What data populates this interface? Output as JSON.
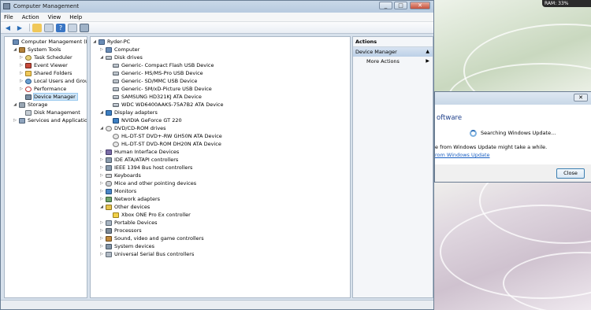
{
  "window": {
    "title": "Computer Management",
    "minimize": "_",
    "maximize": "□",
    "close": "✕"
  },
  "menu": [
    "File",
    "Action",
    "View",
    "Help"
  ],
  "left_tree": [
    {
      "label": "Computer Management (Local",
      "indent": 0,
      "exp": "",
      "icon": "comp"
    },
    {
      "label": "System Tools",
      "indent": 1,
      "exp": "◢",
      "icon": "tool"
    },
    {
      "label": "Task Scheduler",
      "indent": 2,
      "exp": "▷",
      "icon": "clock"
    },
    {
      "label": "Event Viewer",
      "indent": 2,
      "exp": "▷",
      "icon": "evt"
    },
    {
      "label": "Shared Folders",
      "indent": 2,
      "exp": "▷",
      "icon": "fold"
    },
    {
      "label": "Local Users and Groups",
      "indent": 2,
      "exp": "▷",
      "icon": "users"
    },
    {
      "label": "Performance",
      "indent": 2,
      "exp": "▷",
      "icon": "perf"
    },
    {
      "label": "Device Manager",
      "indent": 2,
      "exp": "",
      "icon": "dev",
      "selected": true
    },
    {
      "label": "Storage",
      "indent": 1,
      "exp": "◢",
      "icon": "stor"
    },
    {
      "label": "Disk Management",
      "indent": 2,
      "exp": "",
      "icon": "disk"
    },
    {
      "label": "Services and Applications",
      "indent": 1,
      "exp": "▷",
      "icon": "svc"
    }
  ],
  "device_tree": [
    {
      "label": "Ryder-PC",
      "indent": 0,
      "exp": "◢",
      "icon": "comp"
    },
    {
      "label": "Computer",
      "indent": 1,
      "exp": "▷",
      "icon": "comp"
    },
    {
      "label": "Disk drives",
      "indent": 1,
      "exp": "◢",
      "icon": "drive"
    },
    {
      "label": "Generic- Compact Flash USB Device",
      "indent": 2,
      "exp": "",
      "icon": "drive"
    },
    {
      "label": "Generic- MS/MS-Pro USB Device",
      "indent": 2,
      "exp": "",
      "icon": "drive"
    },
    {
      "label": "Generic- SD/MMC USB Device",
      "indent": 2,
      "exp": "",
      "icon": "drive"
    },
    {
      "label": "Generic- SM/xD-Picture USB Device",
      "indent": 2,
      "exp": "",
      "icon": "drive"
    },
    {
      "label": "SAMSUNG HD321KJ ATA Device",
      "indent": 2,
      "exp": "",
      "icon": "drive"
    },
    {
      "label": "WDC WD6400AAKS-75A7B2 ATA Device",
      "indent": 2,
      "exp": "",
      "icon": "drive"
    },
    {
      "label": "Display adapters",
      "indent": 1,
      "exp": "◢",
      "icon": "disp"
    },
    {
      "label": "NVIDIA GeForce GT 220",
      "indent": 2,
      "exp": "",
      "icon": "disp"
    },
    {
      "label": "DVD/CD-ROM drives",
      "indent": 1,
      "exp": "◢",
      "icon": "dvd"
    },
    {
      "label": "HL-DT-ST DVD+-RW GH50N ATA Device",
      "indent": 2,
      "exp": "",
      "icon": "dvd"
    },
    {
      "label": "HL-DT-ST DVD-ROM DH20N ATA Device",
      "indent": 2,
      "exp": "",
      "icon": "dvd"
    },
    {
      "label": "Human Interface Devices",
      "indent": 1,
      "exp": "▷",
      "icon": "hid"
    },
    {
      "label": "IDE ATA/ATAPI controllers",
      "indent": 1,
      "exp": "▷",
      "icon": "ide"
    },
    {
      "label": "IEEE 1394 Bus host controllers",
      "indent": 1,
      "exp": "▷",
      "icon": "ide"
    },
    {
      "label": "Keyboards",
      "indent": 1,
      "exp": "▷",
      "icon": "kbd"
    },
    {
      "label": "Mice and other pointing devices",
      "indent": 1,
      "exp": "▷",
      "icon": "mouse"
    },
    {
      "label": "Monitors",
      "indent": 1,
      "exp": "▷",
      "icon": "mon"
    },
    {
      "label": "Network adapters",
      "indent": 1,
      "exp": "▷",
      "icon": "net"
    },
    {
      "label": "Other devices",
      "indent": 1,
      "exp": "◢",
      "icon": "other"
    },
    {
      "label": "Xbox ONE Pro Ex controller",
      "indent": 2,
      "exp": "",
      "icon": "warn"
    },
    {
      "label": "Portable Devices",
      "indent": 1,
      "exp": "▷",
      "icon": "port"
    },
    {
      "label": "Processors",
      "indent": 1,
      "exp": "▷",
      "icon": "cpu"
    },
    {
      "label": "Sound, video and game controllers",
      "indent": 1,
      "exp": "▷",
      "icon": "sound"
    },
    {
      "label": "System devices",
      "indent": 1,
      "exp": "▷",
      "icon": "sys"
    },
    {
      "label": "Universal Serial Bus controllers",
      "indent": 1,
      "exp": "▷",
      "icon": "usb"
    }
  ],
  "actions": {
    "heading": "Actions",
    "section": "Device Manager",
    "section_arrow": "▲",
    "item": "More Actions",
    "item_arrow": "▶"
  },
  "gadget": "RAM: 33%",
  "dialog": {
    "heading": "oftware",
    "status": "Searching Windows Update...",
    "note": "e from Windows Update might take a while.",
    "link": "rom Windows Update",
    "close_label": "Close",
    "x_label": "✕"
  }
}
